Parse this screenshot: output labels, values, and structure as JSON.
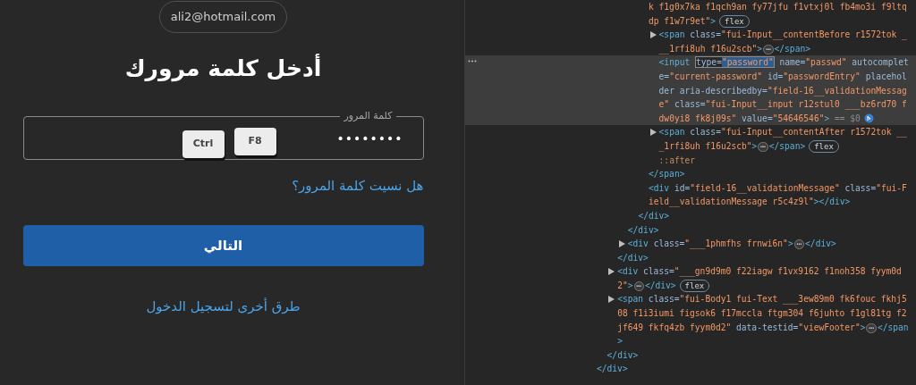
{
  "login": {
    "email": "ali2@hotmail.com",
    "title": "أدخل كلمة مرورك",
    "password_field": {
      "label": "كلمة المرور",
      "value": "••••••••"
    },
    "keys_overlay": [
      "Ctrl",
      "F8"
    ],
    "forgot_link": "هل نسيت كلمة المرور؟",
    "next_button": "التالي",
    "other_ways_link": "طرق أخرى لتسجيل الدخول"
  },
  "devtools": {
    "nodes": [
      {
        "close": [
          {
            "kind": "tag",
            "text": "</div>"
          }
        ],
        "children": [
          {
            "close": [
              {
                "kind": "tag",
                "text": "</div>"
              }
            ],
            "children": [
              {
                "close": [
                  {
                    "kind": "tag",
                    "text": "</div>"
                  }
                ],
                "children": [
                  {
                    "close": [
                      {
                        "kind": "tag",
                        "text": "</div>"
                      }
                    ],
                    "children": [
                      {
                        "close": [
                          {
                            "kind": "tag",
                            "text": "</div>"
                          }
                        ],
                        "children": [
                          {
                            "selected": false,
                            "open": [
                              {
                                "kind": "value",
                                "text": "k f1g0x7ka f1qch9an fy77jfu f1vtxj0l fb4mo3i f9ltqdp f1w7r9et\""
                              },
                              {
                                "kind": "tag",
                                "text": ">"
                              },
                              {
                                "kind": "badge",
                                "text": "flex"
                              }
                            ],
                            "close": [
                              {
                                "kind": "tag",
                                "text": "</span>"
                              }
                            ],
                            "children": [
                              {
                                "collapsed": true,
                                "selected": false,
                                "open": [
                                  {
                                    "kind": "tag",
                                    "text": "<span"
                                  },
                                  {
                                    "kind": "attr",
                                    "text": " class="
                                  },
                                  {
                                    "kind": "value",
                                    "text": "\"fui-Input__contentBefore r1572tok ___1rfi8uh f16u2scb\""
                                  },
                                  {
                                    "kind": "tag",
                                    "text": ">"
                                  },
                                  {
                                    "kind": "more",
                                    "text": "⋯"
                                  },
                                  {
                                    "kind": "tag",
                                    "text": "</span>"
                                  }
                                ]
                              },
                              {
                                "selected": true,
                                "open": [
                                  {
                                    "kind": "tag",
                                    "text": "<input "
                                  },
                                  {
                                    "kind": "edit-attr",
                                    "text": "type="
                                  },
                                  {
                                    "kind": "edit-value",
                                    "text": "\"password\""
                                  },
                                  {
                                    "kind": "attr",
                                    "text": " name="
                                  },
                                  {
                                    "kind": "value",
                                    "text": "\"passwd\""
                                  },
                                  {
                                    "kind": "attr",
                                    "text": " autocomplete="
                                  },
                                  {
                                    "kind": "value",
                                    "text": "\"current-password\""
                                  },
                                  {
                                    "kind": "attr",
                                    "text": " id="
                                  },
                                  {
                                    "kind": "value",
                                    "text": "\"passwordEntry\""
                                  },
                                  {
                                    "kind": "attr",
                                    "text": " placeholder aria-describedby="
                                  },
                                  {
                                    "kind": "value",
                                    "text": "\"field-16__validationMessage\""
                                  },
                                  {
                                    "kind": "attr",
                                    "text": " class="
                                  },
                                  {
                                    "kind": "value",
                                    "text": "\"fui-Input__input r12stul0 ___bz6rd70 fdw0yi8 fk8j09s\""
                                  },
                                  {
                                    "kind": "attr",
                                    "text": " value="
                                  },
                                  {
                                    "kind": "value",
                                    "text": "\"54646546\""
                                  },
                                  {
                                    "kind": "tag",
                                    "text": ">"
                                  },
                                  {
                                    "kind": "comment",
                                    "text": " == $0"
                                  }
                                ]
                              },
                              {
                                "collapsed": true,
                                "selected": false,
                                "open": [
                                  {
                                    "kind": "tag",
                                    "text": "<span"
                                  },
                                  {
                                    "kind": "attr",
                                    "text": " class="
                                  },
                                  {
                                    "kind": "value",
                                    "text": "\"fui-Input__contentAfter r1572tok ___1rfi8uh f16u2scb\""
                                  },
                                  {
                                    "kind": "tag",
                                    "text": ">"
                                  },
                                  {
                                    "kind": "more",
                                    "text": "⋯"
                                  },
                                  {
                                    "kind": "tag",
                                    "text": "</span>"
                                  },
                                  {
                                    "kind": "badge",
                                    "text": "flex"
                                  }
                                ]
                              },
                              {
                                "selected": false,
                                "open": [
                                  {
                                    "kind": "pseudo",
                                    "text": "::after"
                                  }
                                ]
                              }
                            ]
                          },
                          {
                            "selected": false,
                            "open": [
                              {
                                "kind": "tag",
                                "text": "<div"
                              },
                              {
                                "kind": "attr",
                                "text": " id="
                              },
                              {
                                "kind": "value",
                                "text": "\"field-16__validationMessage\""
                              },
                              {
                                "kind": "attr",
                                "text": " class="
                              },
                              {
                                "kind": "value",
                                "text": "\"fui-Field__validationMessage r5c4z9l\""
                              },
                              {
                                "kind": "tag",
                                "text": "></div>"
                              }
                            ]
                          }
                        ]
                      }
                    ]
                  },
                  {
                    "collapsed": true,
                    "selected": false,
                    "open": [
                      {
                        "kind": "tag",
                        "text": "<div"
                      },
                      {
                        "kind": "attr",
                        "text": " class="
                      },
                      {
                        "kind": "value",
                        "text": "\"___1phmfhs frnwi6n\""
                      },
                      {
                        "kind": "tag",
                        "text": ">"
                      },
                      {
                        "kind": "more",
                        "text": "⋯"
                      },
                      {
                        "kind": "tag",
                        "text": "</div>"
                      }
                    ]
                  }
                ]
              },
              {
                "collapsed": true,
                "selected": false,
                "open": [
                  {
                    "kind": "tag",
                    "text": "<div"
                  },
                  {
                    "kind": "attr",
                    "text": " class="
                  },
                  {
                    "kind": "value",
                    "text": "\"___gn9d9m0 f22iagw f1vx9162 f1noh358 fyym0d2\""
                  },
                  {
                    "kind": "tag",
                    "text": ">"
                  },
                  {
                    "kind": "more",
                    "text": "⋯"
                  },
                  {
                    "kind": "tag",
                    "text": "</div>"
                  },
                  {
                    "kind": "badge",
                    "text": "flex"
                  }
                ]
              },
              {
                "collapsed": true,
                "selected": false,
                "open": [
                  {
                    "kind": "tag",
                    "text": "<span"
                  },
                  {
                    "kind": "attr",
                    "text": " class="
                  },
                  {
                    "kind": "value",
                    "text": "\"fui-Body1 fui-Text ___3ew89m0 fk6fouc fkhj508 f1i3iumi figsok6 f17mccla ftgm304 f6juhto f1gl81tg f2jf649 fkfq4zb fyym0d2\""
                  },
                  {
                    "kind": "attr",
                    "text": " data-testid="
                  },
                  {
                    "kind": "value",
                    "text": "\"viewFooter\""
                  },
                  {
                    "kind": "tag",
                    "text": ">"
                  },
                  {
                    "kind": "more",
                    "text": "⋯"
                  },
                  {
                    "kind": "tag",
                    "text": "</span>"
                  }
                ]
              }
            ]
          }
        ]
      }
    ]
  }
}
